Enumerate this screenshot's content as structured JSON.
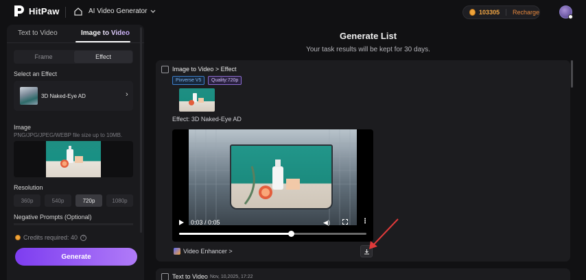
{
  "header": {
    "logo_text": "HitPaw",
    "app_title": "AI Video Generator",
    "credits": "103305",
    "recharge": "Recharge"
  },
  "left": {
    "tabs": [
      {
        "label": "Text to Video"
      },
      {
        "label": "Image to Video"
      }
    ],
    "mode": {
      "frame": "Frame",
      "effect": "Effect"
    },
    "select_effect_label": "Select an Effect",
    "effect_name": "3D Naked-Eye AD",
    "image_label": "Image",
    "image_hint": "PNG/JPG/JPEG/WEBP file size up to 10MB.",
    "resolution_label": "Resolution",
    "resolutions": [
      "360p",
      "540p",
      "720p",
      "1080p"
    ],
    "active_resolution": "720p",
    "negative_label": "Negative Prompts (Optional)",
    "credits_required": "Credits required: 40",
    "generate": "Generate"
  },
  "main": {
    "title": "Generate List",
    "subtitle": "Your task results will be kept for 30 days.",
    "task": {
      "title": "Image to Video > Effect",
      "model": "Pixverse V5",
      "quality": "Quality:720p",
      "effect": "Effect: 3D Naked-Eye AD",
      "time": "0:03 / 0:05",
      "progress": 0.6,
      "enhancer": "Video Enhancer >"
    },
    "task2": {
      "title": "Text to Video",
      "time": "Nov, 10,2025, 17:22"
    }
  },
  "colors": {
    "accent_start": "#7d3df0",
    "accent_end": "#b07bf8",
    "credits": "#f3a643",
    "annotation_arrow": "#e03a3a"
  }
}
